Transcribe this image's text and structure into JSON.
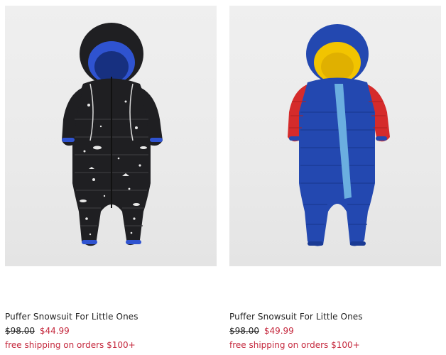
{
  "products": [
    {
      "image_alt": "image",
      "title": "Puffer Snowsuit For Little Ones",
      "original_price": "$98.00",
      "sale_price": "$44.99",
      "promo": "free shipping on orders $100+",
      "colors": {
        "body": "#1f1f22",
        "hood_lining": "#2f53d0",
        "trim": "#2f53d0",
        "pattern": "#e8e8e8"
      }
    },
    {
      "image_alt": "image",
      "title": "Puffer Snowsuit For Little Ones",
      "original_price": "$98.00",
      "sale_price": "$49.99",
      "promo": "free shipping on orders $100+",
      "colors": {
        "body": "#2348b0",
        "hood_lining": "#f2c400",
        "sleeves": "#d52b2b",
        "zip_panel": "#6aaee0"
      }
    }
  ],
  "accent_colors": {
    "sale": "#c5283d",
    "text": "#222222"
  }
}
